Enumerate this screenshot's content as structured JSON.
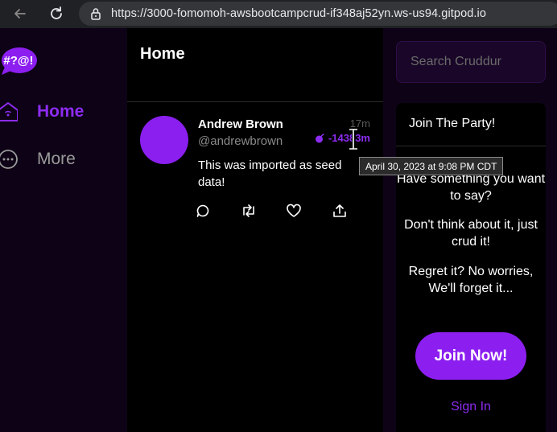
{
  "browser": {
    "url": "https://3000-fomomoh-awsbootcampcrud-if348aj52yn.ws-us94.gitpod.io"
  },
  "nav": {
    "logo_text": "#?@!",
    "items": [
      {
        "label": "Home",
        "icon": "home-icon"
      },
      {
        "label": "More",
        "icon": "more-icon"
      }
    ]
  },
  "main": {
    "title": "Home",
    "activity": {
      "display_name": "Andrew Brown",
      "handle": "@andrewbrown",
      "created": "17m",
      "expires": "-14383m",
      "message": "This was imported as seed data!",
      "tooltip": "April 30, 2023 at 9:08 PM CDT"
    }
  },
  "sidebar": {
    "search_placeholder": "Search Cruddur",
    "party_title": "Join The Party!",
    "text1": "Have something you want to say?",
    "text2": "Don't think about it, just crud it!",
    "text3": "Regret it? No worries, We'll forget it...",
    "join_button": "Join Now!",
    "sign_in": "Sign In"
  },
  "colors": {
    "accent": "#8c1ff0",
    "background": "#0e0316",
    "panel": "#000000"
  }
}
